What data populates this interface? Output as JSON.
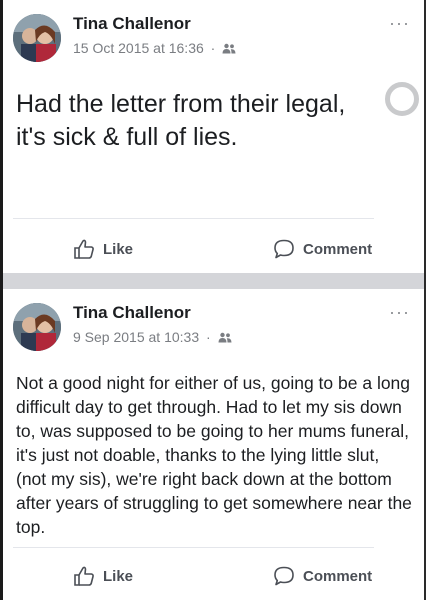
{
  "posts": [
    {
      "author": "Tina Challenor",
      "date": "15 Oct 2015 at 16:36",
      "separator": "·",
      "audience_icon": "friends-icon",
      "more": "···",
      "text_line1": "Had the letter from their legal,",
      "text_line2": "it's  sick & full of lies.",
      "like_label": "Like",
      "comment_label": "Comment"
    },
    {
      "author": "Tina Challenor",
      "date": "9 Sep 2015 at 10:33",
      "separator": "·",
      "audience_icon": "friends-icon",
      "more": "···",
      "text": "Not a good night for either of us, going to be a long difficult day to get through. Had to let my sis down to, was supposed to be going to her mums funeral, it's just not doable, thanks to the lying little slut, (not my sis), we're right back down at the bottom after years of struggling to get somewhere near the top.",
      "like_label": "Like",
      "comment_label": "Comment"
    }
  ],
  "colors": {
    "author": "#1c1e21",
    "meta": "#7a7d82",
    "action": "#4b4f56",
    "separator_band": "#d4d5d9"
  }
}
